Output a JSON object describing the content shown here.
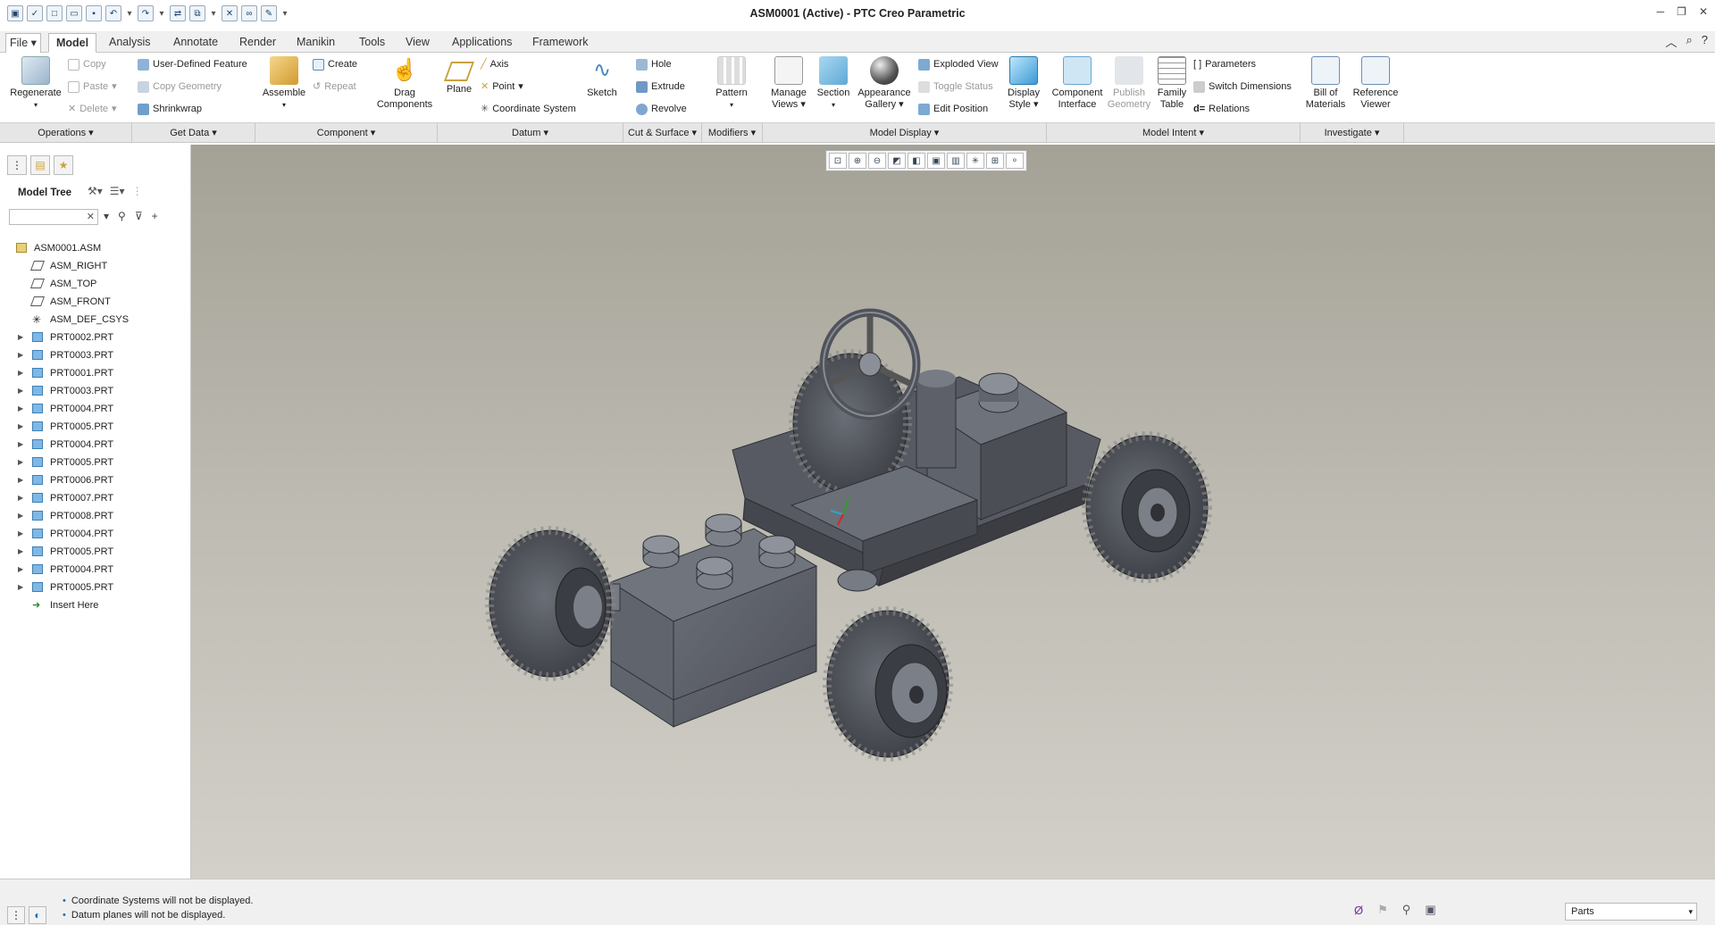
{
  "window": {
    "title": "ASM0001 (Active) - PTC Creo Parametric",
    "controls": [
      "─",
      "❐",
      "✕"
    ]
  },
  "tabs": [
    "File ▾",
    "Model",
    "Analysis",
    "Annotate",
    "Render",
    "Manikin",
    "Tools",
    "View",
    "Applications",
    "Framework"
  ],
  "ribbon": {
    "regenerate": "Regenerate",
    "copy": "Copy",
    "paste": "Paste",
    "delete": "Delete",
    "udf": "User-Defined Feature",
    "copy_geometry": "Copy Geometry",
    "shrinkwrap": "Shrinkwrap",
    "assemble": "Assemble",
    "create": "Create",
    "repeat": "Repeat",
    "drag_components": "Drag Components",
    "plane": "Plane",
    "axis": "Axis",
    "point": "Point",
    "coordinate_system": "Coordinate System",
    "sketch": "Sketch",
    "hole": "Hole",
    "extrude": "Extrude",
    "revolve": "Revolve",
    "pattern": "Pattern",
    "manage_views": "Manage Views",
    "section": "Section",
    "appearance_gallery": "Appearance Gallery",
    "exploded_view": "Exploded View",
    "toggle_status": "Toggle Status",
    "edit_position": "Edit Position",
    "display_style": "Display Style",
    "component_interface": "Component Interface",
    "publish_geometry": "Publish Geometry",
    "family_table": "Family Table",
    "parameters": "Parameters",
    "switch_dimensions": "Switch Dimensions",
    "relations": "Relations",
    "bill_of_materials": "Bill of Materials",
    "reference_viewer": "Reference Viewer"
  },
  "groups": [
    "Operations ▾",
    "Get Data ▾",
    "Component ▾",
    "Datum ▾",
    "Cut & Surface ▾",
    "Modifiers ▾",
    "Model Display ▾",
    "Model Intent ▾",
    "Investigate ▾"
  ],
  "panel": {
    "model_tree_label": "Model Tree",
    "search_value": ""
  },
  "tree": [
    {
      "label": "ASM0001.ASM",
      "icon": "assembly-icon"
    },
    {
      "label": "ASM_RIGHT",
      "icon": "datum-plane-icon"
    },
    {
      "label": "ASM_TOP",
      "icon": "datum-plane-icon"
    },
    {
      "label": "ASM_FRONT",
      "icon": "datum-plane-icon"
    },
    {
      "label": "ASM_DEF_CSYS",
      "icon": "csys-icon"
    },
    {
      "label": "PRT0002.PRT",
      "icon": "part-icon"
    },
    {
      "label": "PRT0003.PRT",
      "icon": "part-icon"
    },
    {
      "label": "PRT0001.PRT",
      "icon": "part-icon"
    },
    {
      "label": "PRT0003.PRT",
      "icon": "part-icon"
    },
    {
      "label": "PRT0004.PRT",
      "icon": "part-icon"
    },
    {
      "label": "PRT0005.PRT",
      "icon": "part-icon"
    },
    {
      "label": "PRT0004.PRT",
      "icon": "part-icon"
    },
    {
      "label": "PRT0005.PRT",
      "icon": "part-icon"
    },
    {
      "label": "PRT0006.PRT",
      "icon": "part-icon"
    },
    {
      "label": "PRT0007.PRT",
      "icon": "part-icon"
    },
    {
      "label": "PRT0008.PRT",
      "icon": "part-icon"
    },
    {
      "label": "PRT0004.PRT",
      "icon": "part-icon"
    },
    {
      "label": "PRT0005.PRT",
      "icon": "part-icon"
    },
    {
      "label": "PRT0004.PRT",
      "icon": "part-icon"
    },
    {
      "label": "PRT0005.PRT",
      "icon": "part-icon"
    },
    {
      "label": "Insert Here",
      "icon": "insert-arrow-icon"
    }
  ],
  "status": {
    "messages": [
      "Coordinate Systems will not be displayed.",
      "Datum planes will not be displayed."
    ],
    "filter": "Parts"
  },
  "colors": {
    "accent": "#1a6fb5",
    "model_gray": "#5a5e66",
    "viewport_top": "#a4a196",
    "viewport_bottom": "#d2d0c8"
  }
}
